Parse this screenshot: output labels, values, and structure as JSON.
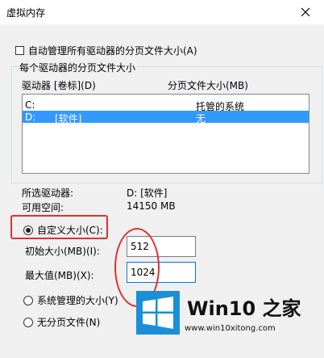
{
  "window": {
    "title": "虚拟内存"
  },
  "auto_manage": {
    "label": "自动管理所有驱动器的分页文件大小(A)",
    "checked": false
  },
  "group": {
    "legend": "每个驱动器的分页文件大小"
  },
  "list": {
    "headers": {
      "drive": "驱动器 [卷标](D)",
      "size": "分页文件大小(MB)"
    },
    "rows": [
      {
        "drive": "C:",
        "label": "",
        "size": "托管的系统",
        "selected": false
      },
      {
        "drive": "D:",
        "label": "[软件]",
        "size": "无",
        "selected": true
      }
    ]
  },
  "selected_drive": {
    "label": "所选驱动器:",
    "value": "D:  [软件]"
  },
  "available_space": {
    "label": "可用空间:",
    "value": "14150 MB"
  },
  "options": {
    "custom": {
      "label": "自定义大小(C):",
      "checked": true
    },
    "system": {
      "label": "系统管理的大小(Y)",
      "checked": false
    },
    "none": {
      "label": "无分页文件(N)",
      "checked": false
    }
  },
  "fields": {
    "initial": {
      "label": "初始大小(MB)(I):",
      "value": "512"
    },
    "maximum": {
      "label": "最大值(MB)(X):",
      "value": "1024"
    }
  },
  "watermark": {
    "title": "Win10 之家",
    "url": "www.win10xitong.com"
  },
  "colors": {
    "selection": "#3399ff",
    "annotation": "#e03030",
    "logo_blue": "#1a8fd8"
  }
}
